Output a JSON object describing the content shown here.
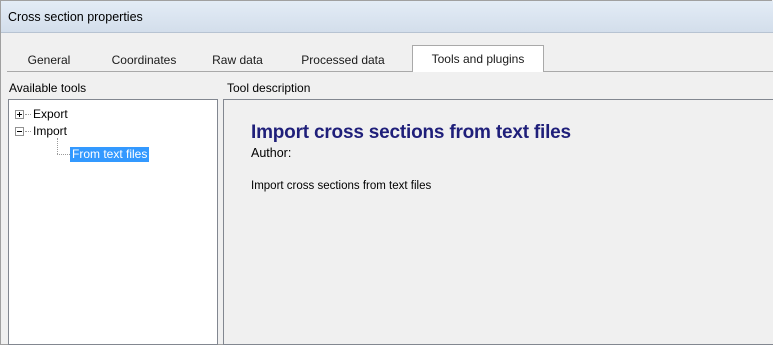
{
  "window": {
    "title": "Cross section properties"
  },
  "tabs": [
    {
      "label": "General"
    },
    {
      "label": "Coordinates"
    },
    {
      "label": "Raw data"
    },
    {
      "label": "Processed data"
    },
    {
      "label": "Tools and plugins",
      "active": true
    }
  ],
  "left_panel": {
    "header": "Available tools",
    "tree": [
      {
        "label": "Export",
        "expanded": false
      },
      {
        "label": "Import",
        "expanded": true,
        "children": [
          {
            "label": "From text files",
            "selected": true
          }
        ]
      }
    ]
  },
  "right_panel": {
    "header": "Tool description",
    "tool_title": "Import cross sections from text files",
    "author_label": "Author:",
    "description": "Import cross sections from text files"
  },
  "colors": {
    "title_text": "#1f1f7a",
    "selection": "#3399ff"
  }
}
